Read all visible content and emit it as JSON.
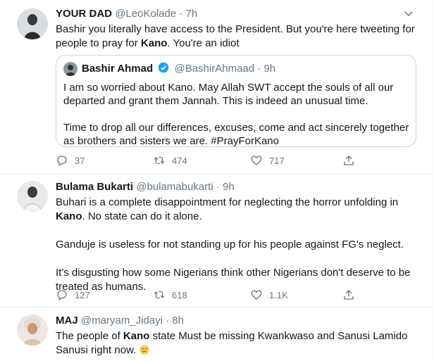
{
  "tweets": [
    {
      "name": "YOUR DAD",
      "handle": "@LeoKolade",
      "time": "7h",
      "text_1_a": "Bashir you literally have access to the President. But you're here tweeting for people to pray for ",
      "text_1_kw": "Kano",
      "text_1_b": ". You're an idiot",
      "quote": {
        "name": "Bashir Ahmad",
        "handle": "@BashirAhmaad",
        "time": "9h",
        "para_1": "I am so worried about Kano. May Allah SWT accept the souls of all our departed and grant them Jannah. This is indeed an unusual time.",
        "para_2": "Time to drop all our differences, excuses, come and act sincerely together as brothers and sisters we are. #PrayForKano"
      },
      "replies": "37",
      "retweets": "474",
      "likes": "717"
    },
    {
      "name": "Bulama Bukarti",
      "handle": "@bulamabukarti",
      "time": "9h",
      "para_1_a": "Buhari is a complete disappointment for neglecting the horror unfolding in ",
      "para_1_kw": "Kano",
      "para_1_b": ". No state can do it alone.",
      "para_2": "Ganduje is useless for not standing up for his people against FG's neglect.",
      "para_3": "It's disgusting how some Nigerians think other Nigerians don't deserve to be treated as humans.",
      "replies": "127",
      "retweets": "618",
      "likes": "1.1K"
    },
    {
      "name": "MAJ",
      "handle": "@maryam_Jidayi",
      "time": "8h",
      "text_a": "The people of ",
      "text_kw": "Kano",
      "text_b": " state Must be missing Kwankwaso and Sanusi Lamido Sanusi right now."
    }
  ],
  "separator": " · ",
  "colors": {
    "meta": "#657786",
    "border": "#e6ecf0",
    "verified": "#1da1f2"
  },
  "icons": [
    "chevron-down-icon",
    "reply-icon",
    "retweet-icon",
    "like-icon",
    "share-icon",
    "verified-icon",
    "crying-emoji"
  ]
}
